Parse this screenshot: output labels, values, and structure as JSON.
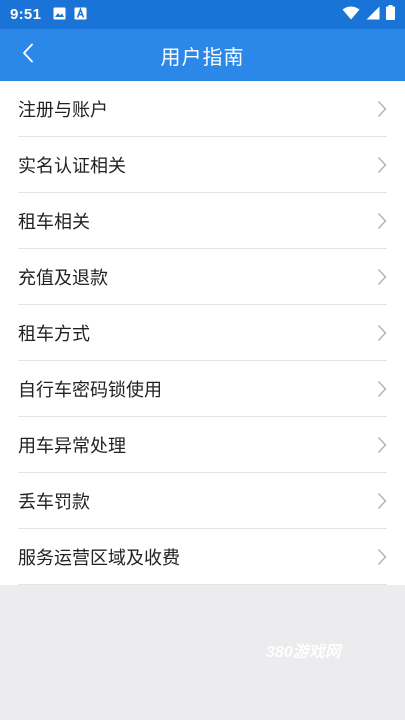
{
  "status_bar": {
    "time": "9:51",
    "left_icons": [
      "image-icon",
      "text-a-icon"
    ],
    "right_icons": [
      "wifi-icon",
      "signal-icon",
      "battery-icon"
    ]
  },
  "app_bar": {
    "back_icon": "chevron-left-icon",
    "title": "用户指南"
  },
  "menu": {
    "items": [
      {
        "label": "注册与账户"
      },
      {
        "label": "实名认证相关"
      },
      {
        "label": "租车相关"
      },
      {
        "label": "充值及退款"
      },
      {
        "label": "租车方式"
      },
      {
        "label": "自行车密码锁使用"
      },
      {
        "label": "用车异常处理"
      },
      {
        "label": "丢车罚款"
      },
      {
        "label": "服务运营区域及收费"
      }
    ],
    "item_icon": "chevron-right-icon"
  },
  "watermark": "380游戏网",
  "colors": {
    "status_bar": "#1a73d6",
    "app_bar": "#2b87e8",
    "list_bg": "#ffffff",
    "page_bg": "#ececee",
    "divider": "#e3e3e3",
    "chevron": "#b5b5b5"
  }
}
